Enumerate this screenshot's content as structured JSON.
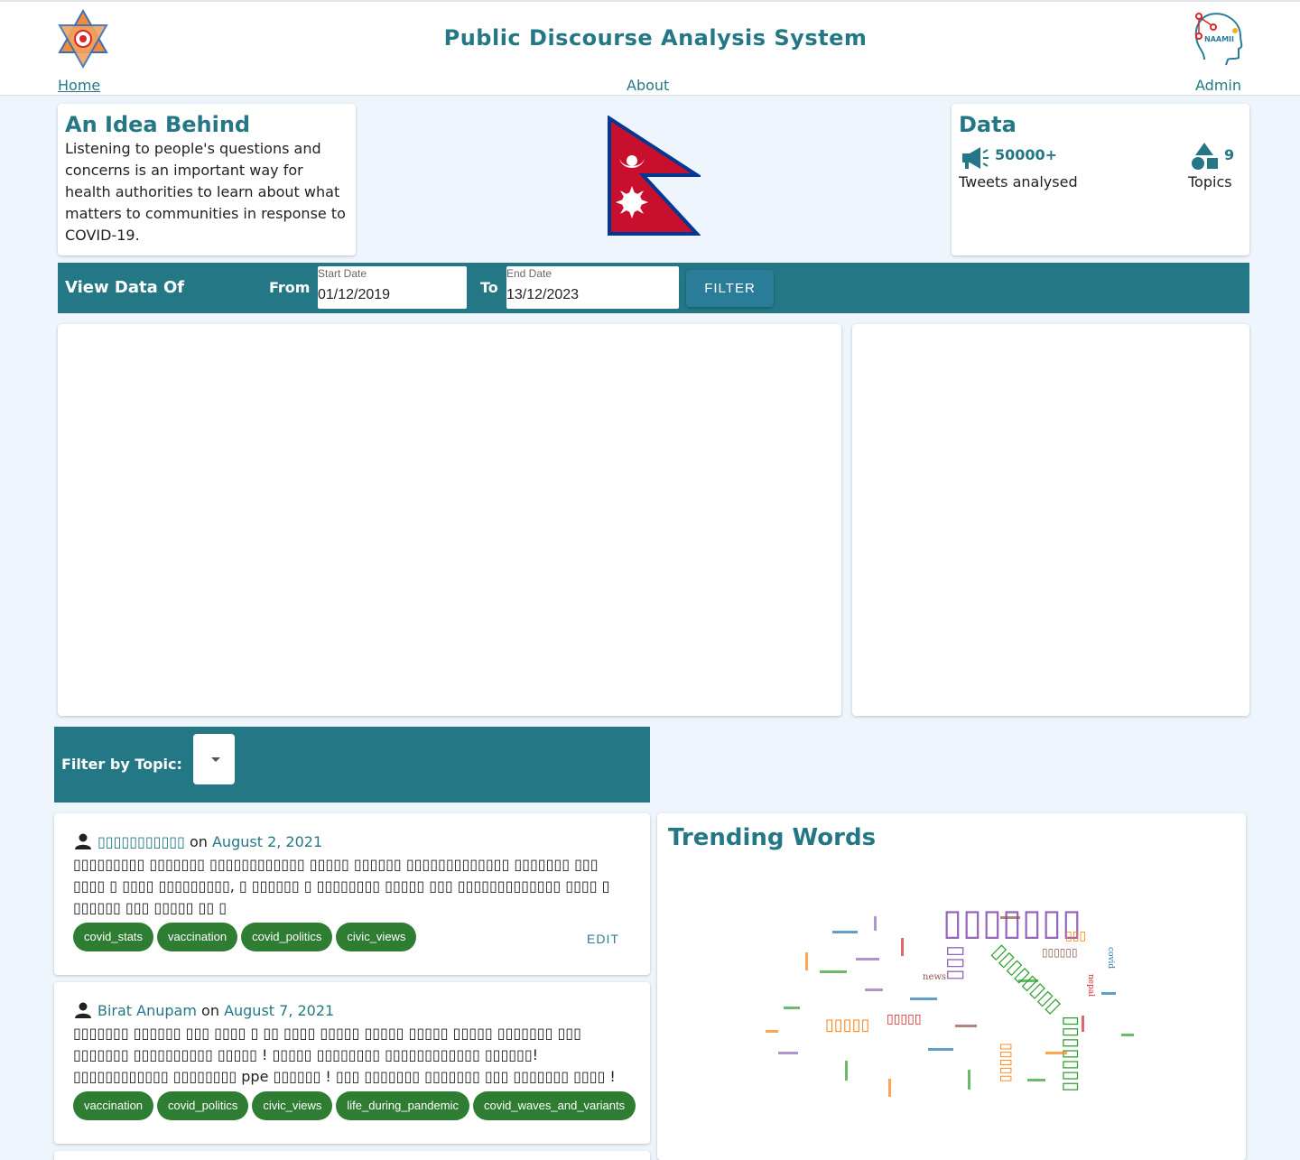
{
  "header": {
    "title": "Public Discourse Analysis System",
    "nav": {
      "home": "Home",
      "about": "About",
      "admin": "Admin"
    },
    "logo_right_text": "NAAMII"
  },
  "idea": {
    "heading": "An Idea Behind",
    "text": "Listening to people's questions and concerns is an important way for health authorities to learn about what matters to communities in response to COVID-19."
  },
  "data_card": {
    "heading": "Data",
    "tweets_value": "50000+",
    "tweets_label": "Tweets analysed",
    "topics_value": "9",
    "topics_label": "Topics"
  },
  "filter": {
    "title": "View Data Of",
    "from_label": "From",
    "to_label": "To",
    "start_label": "Start Date",
    "start_value": "01/12/2019",
    "end_label": "End Date",
    "end_value": "13/12/2023",
    "button": "FILTER"
  },
  "topic_filter": {
    "label": "Filter by Topic:"
  },
  "posts": [
    {
      "author": "▯▯▯▯▯▯▯▯▯▯▯",
      "on": "on",
      "date": "August 2, 2021",
      "body": "▯▯▯▯▯▯▯▯▯ ▯▯▯▯▯▯▯ ▯▯▯▯▯▯▯▯▯▯▯▯ ▯▯▯▯▯ ▯▯▯▯▯▯ ▯▯▯▯▯▯▯▯▯▯▯▯▯ ▯▯▯▯▯▯▯ ▯▯▯ ▯▯▯▯ ▯ ▯▯▯▯ ▯▯▯▯▯▯▯▯▯, ▯ ▯▯▯▯▯▯ ▯ ▯▯▯▯▯▯▯▯ ▯▯▯▯▯ ▯▯▯ ▯▯▯▯▯▯▯▯▯▯▯▯▯ ▯▯▯▯ ▯ ▯▯▯▯▯▯ ▯▯▯ ▯▯▯▯▯ ▯▯ ▯",
      "tags": [
        "covid_stats",
        "vaccination",
        "covid_politics",
        "civic_views"
      ],
      "edit": "EDIT"
    },
    {
      "author": "Birat Anupam",
      "on": "on",
      "date": "August 7, 2021",
      "body": "▯▯▯▯▯▯▯ ▯▯▯▯▯▯ ▯▯▯ ▯▯▯▯ ▯ ▯▯ ▯▯▯▯ ▯▯▯▯▯ ▯▯▯▯▯ ▯▯▯▯▯ ▯▯▯▯▯ ▯▯▯▯▯▯▯ ▯▯▯ ▯▯▯▯▯▯▯ ▯▯▯▯▯▯▯▯▯▯ ▯▯▯▯▯ ! ▯▯▯▯▯ ▯▯▯▯▯▯▯▯ ▯▯▯▯▯▯▯▯▯▯▯▯ ▯▯▯▯▯▯! ▯▯▯▯▯▯▯▯▯▯▯▯ ▯▯▯▯▯▯▯▯ ppe ▯▯▯▯▯▯ ! ▯▯▯ ▯▯▯▯▯▯▯ ▯▯▯▯▯▯▯ ▯▯▯ ▯▯▯▯▯▯▯ ▯▯▯▯ !",
      "tags": [
        "vaccination",
        "covid_politics",
        "civic_views",
        "life_during_pandemic",
        "covid_waves_and_variants"
      ],
      "edit": ""
    }
  ],
  "trending": {
    "heading": "Trending Words",
    "words": [
      {
        "text": "▯▯▯▯▯▯▯",
        "color": "#9467bd"
      },
      {
        "text": "▯▯▯▯▯▯▯▯",
        "color": "#2ca02c"
      },
      {
        "text": "▯▯▯▯▯▯▯",
        "color": "#2ca02c"
      },
      {
        "text": "▯▯▯▯▯",
        "color": "#ff7f0e"
      },
      {
        "text": "▯▯▯▯▯",
        "color": "#d62728"
      },
      {
        "text": "▯▯▯▯▯",
        "color": "#ff7f0e"
      },
      {
        "text": "▯▯▯",
        "color": "#9467bd"
      },
      {
        "text": "▯▯▯▯▯▯",
        "color": "#8c564b"
      },
      {
        "text": "▯▯▯",
        "color": "#ff7f0e"
      },
      {
        "text": "news",
        "color": "#8c564b"
      },
      {
        "text": "nepal",
        "color": "#d62728"
      },
      {
        "text": "covid",
        "color": "#1f77b4"
      }
    ]
  }
}
